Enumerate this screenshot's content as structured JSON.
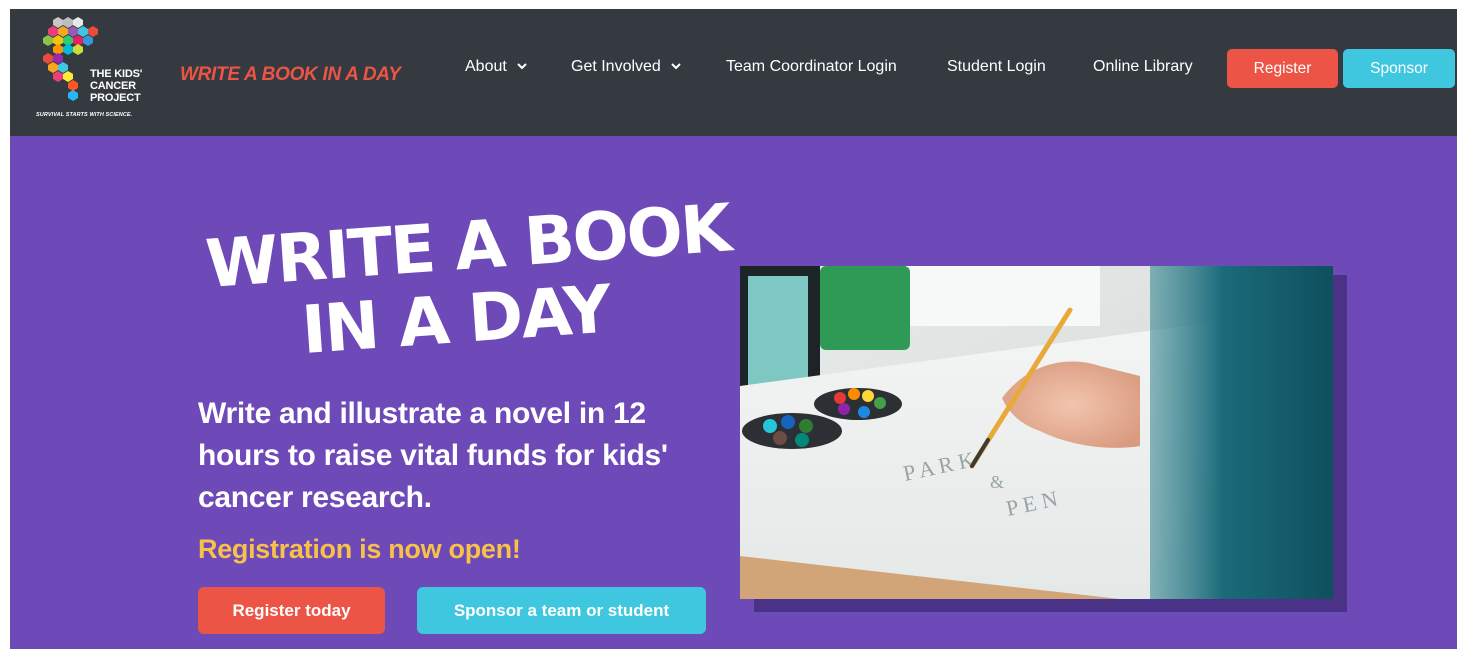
{
  "logo": {
    "line1": "THE KIDS'",
    "line2": "CANCER",
    "line3": "PROJECT",
    "tagline": "SURVIVAL STARTS WITH SCIENCE.",
    "icon": "hexagon-cluster-logo"
  },
  "brand": "WRITE A BOOK IN A DAY",
  "nav": {
    "about": "About",
    "get_involved": "Get Involved",
    "team_login": "Team Coordinator Login",
    "student_login": "Student Login",
    "online_library": "Online Library",
    "register": "Register",
    "sponsor": "Sponsor"
  },
  "hero": {
    "title_line1": "WRITE A BOOK",
    "title_line2": "IN A DAY",
    "description": "Write and illustrate a novel in 12 hours to raise vital funds for kids' cancer research.",
    "status": "Registration is now open!",
    "register_cta": "Register today",
    "sponsor_cta": "Sponsor a team or student",
    "image": "child-painting-photo"
  },
  "colors": {
    "header_bg": "#353a40",
    "hero_bg": "#6e4ab9",
    "accent_red": "#ec5545",
    "accent_cyan": "#3fc7e0",
    "accent_yellow": "#f7c14a"
  }
}
